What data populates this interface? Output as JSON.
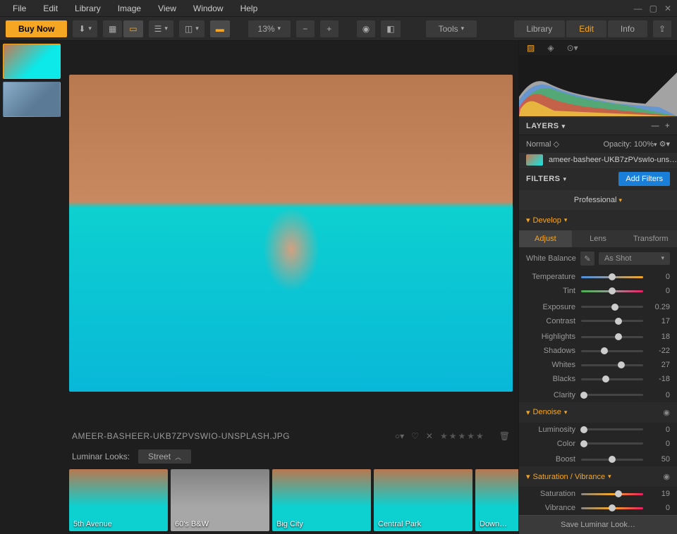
{
  "menubar": {
    "items": [
      "File",
      "Edit",
      "Library",
      "Image",
      "View",
      "Window",
      "Help"
    ]
  },
  "toolbar": {
    "buy_now": "Buy Now",
    "zoom": "13%",
    "tools": "Tools"
  },
  "top_tabs": {
    "library": "Library",
    "edit": "Edit",
    "info": "Info"
  },
  "meta": {
    "filename": "AMEER-BASHEER-UKB7ZPVSWIO-UNSPLASH.JPG"
  },
  "looks": {
    "label": "Luminar Looks:",
    "category": "Street",
    "items": [
      "5th Avenue",
      "60's B&W",
      "Big City",
      "Central Park",
      "Down…"
    ]
  },
  "layers": {
    "title": "LAYERS",
    "blend_mode": "Normal",
    "opacity_label": "Opacity:",
    "opacity_value": "100%",
    "layer_name": "ameer-basheer-UKB7zPVswIo-uns…"
  },
  "filters": {
    "title": "FILTERS",
    "add": "Add Filters",
    "preset": "Professional",
    "develop": {
      "title": "Develop",
      "tabs": [
        "Adjust",
        "Lens",
        "Transform"
      ],
      "wb_label": "White Balance",
      "wb_value": "As Shot",
      "sliders": {
        "temperature": {
          "label": "Temperature",
          "value": 0,
          "pos": 50
        },
        "tint": {
          "label": "Tint",
          "value": 0,
          "pos": 50
        },
        "exposure": {
          "label": "Exposure",
          "value": "0.29",
          "pos": 55
        },
        "contrast": {
          "label": "Contrast",
          "value": 17,
          "pos": 60
        },
        "highlights": {
          "label": "Highlights",
          "value": 18,
          "pos": 60
        },
        "shadows": {
          "label": "Shadows",
          "value": -22,
          "pos": 38
        },
        "whites": {
          "label": "Whites",
          "value": 27,
          "pos": 65
        },
        "blacks": {
          "label": "Blacks",
          "value": -18,
          "pos": 40
        },
        "clarity": {
          "label": "Clarity",
          "value": 0,
          "pos": 5
        }
      }
    },
    "denoise": {
      "title": "Denoise",
      "luminosity": {
        "label": "Luminosity",
        "value": 0,
        "pos": 5
      },
      "color": {
        "label": "Color",
        "value": 0,
        "pos": 5
      },
      "boost": {
        "label": "Boost",
        "value": 50,
        "pos": 50
      }
    },
    "satvib": {
      "title": "Saturation / Vibrance",
      "saturation": {
        "label": "Saturation",
        "value": 19,
        "pos": 60
      },
      "vibrance": {
        "label": "Vibrance",
        "value": 0,
        "pos": 50
      }
    }
  },
  "save_look": "Save Luminar Look…"
}
